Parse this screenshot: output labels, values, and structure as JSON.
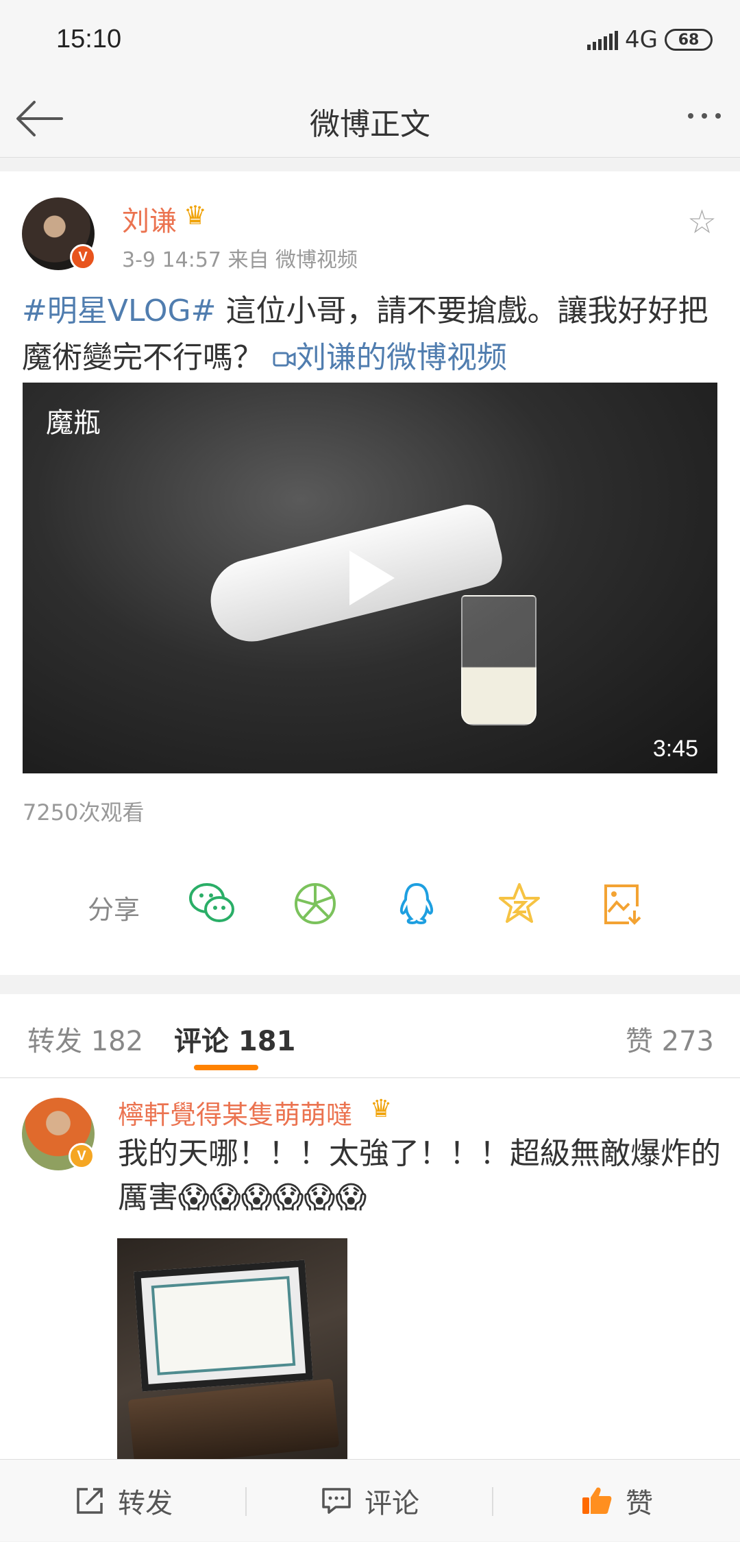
{
  "status_bar": {
    "time": "15:10",
    "network": "4G",
    "battery": "68"
  },
  "nav": {
    "title": "微博正文"
  },
  "post": {
    "author": "刘谦",
    "verified_badge": "V",
    "meta": "3-9 14:57   来自 微博视频",
    "topic": "#明星VLOG#",
    "text": " 這位小哥，請不要搶戲。讓我好好把魔術變完不行嗎？",
    "video_link_icon": "video-link-icon",
    "video_link": "刘谦的微博视频",
    "video": {
      "title": "魔瓶",
      "duration": "3:45"
    },
    "views": "7250次观看"
  },
  "share": {
    "label": "分享",
    "targets": [
      {
        "icon": "wechat-icon",
        "color": "#2aae67"
      },
      {
        "icon": "moments-icon",
        "color": "#7bc25c"
      },
      {
        "icon": "qq-icon",
        "color": "#1e9fe0"
      },
      {
        "icon": "qzone-icon",
        "color": "#f6c343"
      },
      {
        "icon": "save-image-icon",
        "color": "#f3a333"
      }
    ]
  },
  "tabs": {
    "repost": "转发 182",
    "comment": "评论 181",
    "like": "赞 273"
  },
  "comment": {
    "author": "檸軒覺得某隻萌萌噠",
    "verified_badge": "V",
    "text": "我的天哪！！！太強了！！！超級無敵爆炸的厲害😱😱😱😱😱😱"
  },
  "bottom_bar": {
    "repost": "转发",
    "comment": "评论",
    "like": "赞"
  },
  "colors": {
    "accent": "#ff8200",
    "name": "#eb7350",
    "link": "#507daf"
  }
}
